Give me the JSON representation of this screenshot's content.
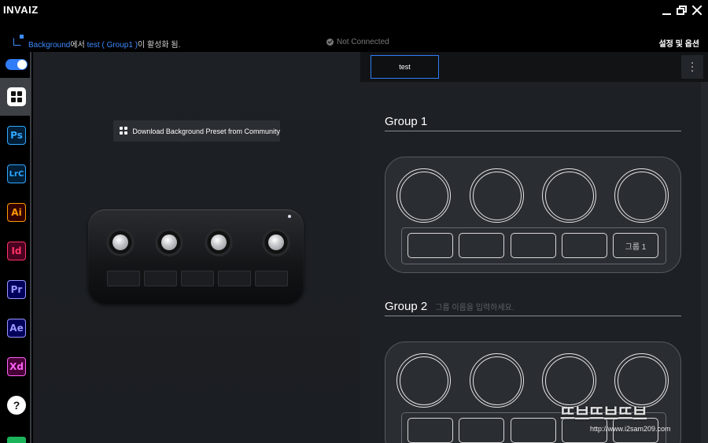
{
  "app": {
    "brand": "INVAIZ"
  },
  "window_controls": {
    "minimize": "minimize",
    "maximize": "maximize",
    "close": "close"
  },
  "status": {
    "source": "Background",
    "text_mid": "에서 ",
    "preset": "test ( Group1 )",
    "text_end": "이 활성화 됨.",
    "connection": "Not Connected",
    "settings_label": "설정 및 옵션"
  },
  "rail": {
    "toggle_on": true,
    "apps": [
      {
        "label": "Ps",
        "color": "#31a8ff",
        "bg": "#001e36"
      },
      {
        "label": "LrC",
        "color": "#31a8ff",
        "bg": "#001e36"
      },
      {
        "label": "Ai",
        "color": "#ff9a00",
        "bg": "#330000"
      },
      {
        "label": "Id",
        "color": "#ff3366",
        "bg": "#49021f"
      },
      {
        "label": "Pr",
        "color": "#9999ff",
        "bg": "#00005b"
      },
      {
        "label": "Ae",
        "color": "#9999ff",
        "bg": "#00005b"
      },
      {
        "label": "Xd",
        "color": "#ff61f6",
        "bg": "#470137"
      }
    ]
  },
  "preview": {
    "download_label": "Download Background Preset from Community"
  },
  "editor": {
    "tab_label": "test",
    "groups": [
      {
        "title": "Group 1",
        "hint": "",
        "key_labels": [
          "",
          "",
          "",
          "",
          "그룹 1"
        ]
      },
      {
        "title": "Group 2",
        "hint": "그룹 이름을 입력하세요.",
        "key_labels": [
          "",
          "",
          "",
          "",
          ""
        ]
      }
    ]
  },
  "watermark": {
    "big": "뜨브뜨브뜨브",
    "url": "http://www.i2sam209.com"
  }
}
